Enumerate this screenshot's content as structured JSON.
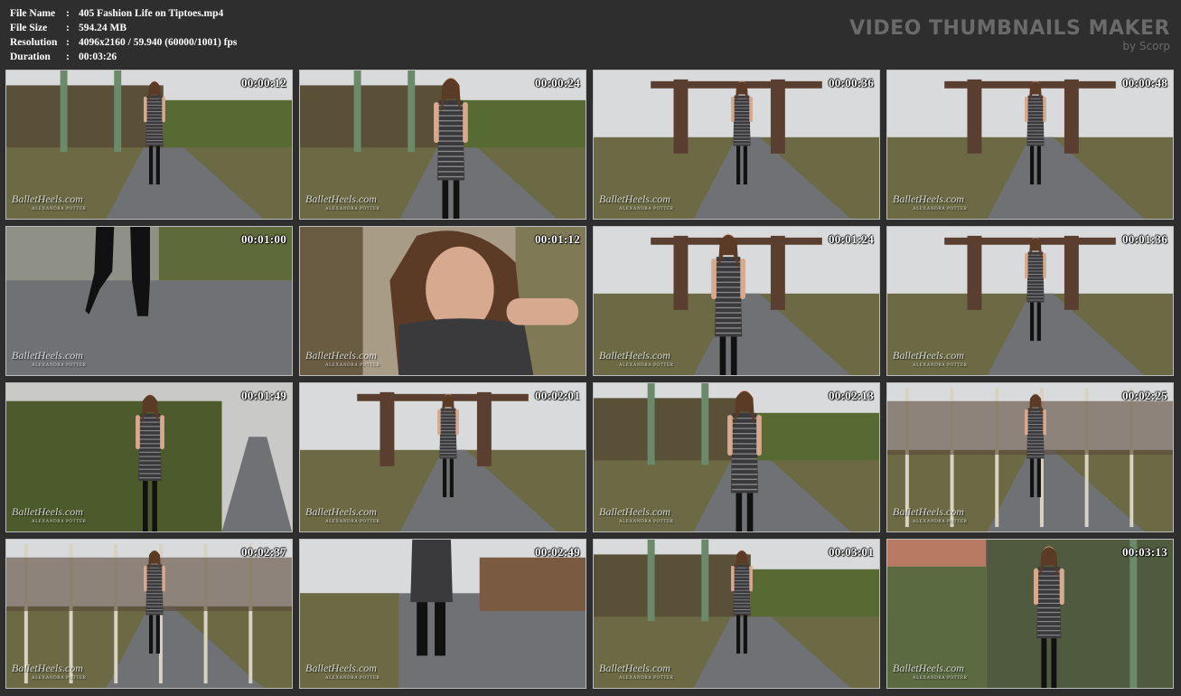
{
  "file_info": {
    "file_name_label": "File Name",
    "file_name": "405 Fashion Life on Tiptoes.mp4",
    "file_size_label": "File Size",
    "file_size": "594.24 MB",
    "resolution_label": "Resolution",
    "resolution": "4096x2160 / 59.940 (60000/1001) fps",
    "duration_label": "Duration",
    "duration": "00:03:26",
    "separator": ":"
  },
  "brand": {
    "title": "VIDEO THUMBNAILS MAKER",
    "subtitle": "by Scorp"
  },
  "watermark": {
    "main": "BalletHeels.com",
    "sub": "ALEXANDRA POTTER"
  },
  "thumbnails": [
    {
      "timestamp": "00:00:12",
      "scene": "fence-path-full"
    },
    {
      "timestamp": "00:00:24",
      "scene": "fence-path-mid"
    },
    {
      "timestamp": "00:00:36",
      "scene": "industrial-walk"
    },
    {
      "timestamp": "00:00:48",
      "scene": "industrial-walk"
    },
    {
      "timestamp": "00:01:00",
      "scene": "boots-closeup"
    },
    {
      "timestamp": "00:01:12",
      "scene": "face-closeup"
    },
    {
      "timestamp": "00:01:24",
      "scene": "industrial-mid"
    },
    {
      "timestamp": "00:01:36",
      "scene": "industrial-walk"
    },
    {
      "timestamp": "00:01:49",
      "scene": "hedge-profile"
    },
    {
      "timestamp": "00:02:01",
      "scene": "industrial-walk"
    },
    {
      "timestamp": "00:02:13",
      "scene": "fence-path-mid"
    },
    {
      "timestamp": "00:02:25",
      "scene": "birch-trees"
    },
    {
      "timestamp": "00:02:37",
      "scene": "birch-trees"
    },
    {
      "timestamp": "00:02:49",
      "scene": "legs-walk"
    },
    {
      "timestamp": "00:03:01",
      "scene": "fence-path-full"
    },
    {
      "timestamp": "00:03:13",
      "scene": "wall-closeup"
    }
  ],
  "colors": {
    "background": "#2e2e2e",
    "sky": "#d9dadb",
    "path": "#6f7174",
    "grass": "#6b6a45",
    "fence": "#5a5038",
    "dress": "#3a3a3c",
    "skin": "#d7a98f",
    "hair": "#5b3a26"
  }
}
